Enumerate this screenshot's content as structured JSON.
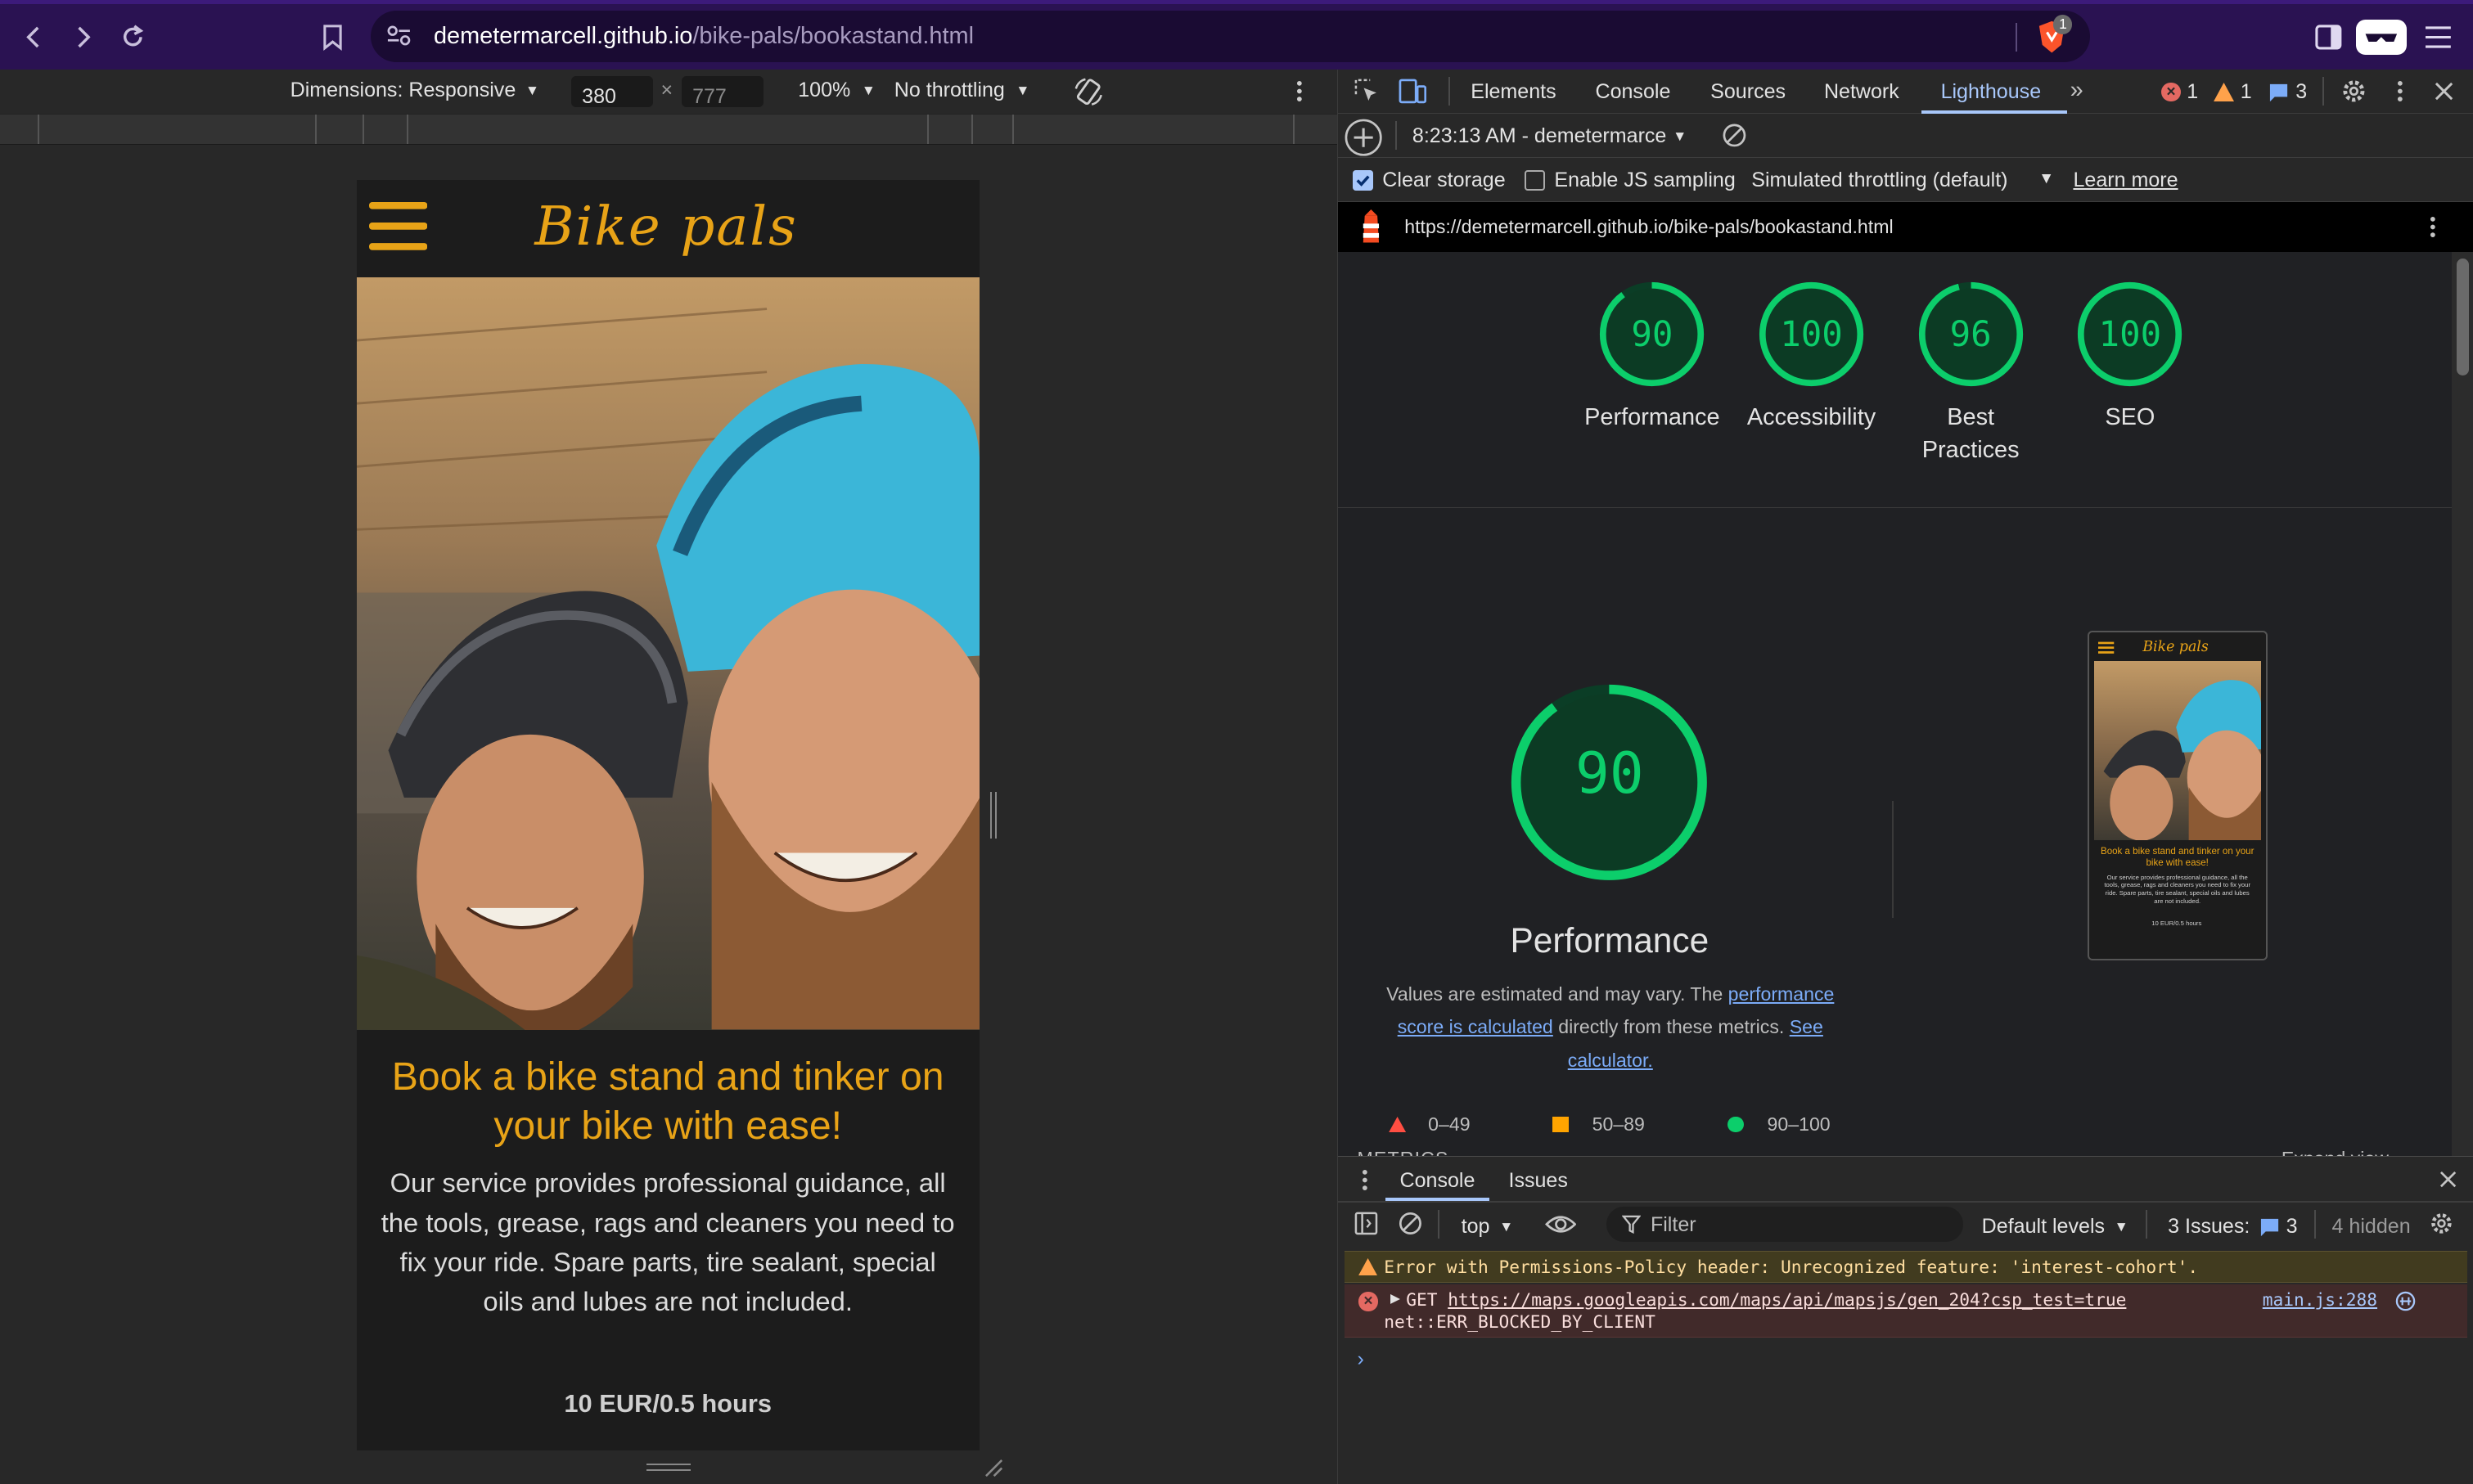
{
  "browser": {
    "url_host": "demetermarcell.github.io",
    "url_path": "/bike-pals/bookastand.html",
    "brave_badge": "1"
  },
  "emulation": {
    "dimensions_label": "Dimensions: Responsive",
    "width": "380",
    "height": "777",
    "zoom": "100%",
    "throttling": "No throttling"
  },
  "page": {
    "logo": "Bike pals",
    "headline": "Book a bike stand and tinker on your bike with ease!",
    "body": "Our service provides professional guidance, all the tools, grease, rags and cleaners you need to fix your ride. Spare parts, tire sealant, special oils and lubes are not included.",
    "price": "10 EUR/0.5 hours"
  },
  "devtools": {
    "tabs": [
      "Elements",
      "Console",
      "Sources",
      "Network",
      "Lighthouse"
    ],
    "active_tab": "Lighthouse",
    "errors": "1",
    "warnings": "1",
    "issues": "3"
  },
  "lighthouse": {
    "report_time": "8:23:13 AM - demetermarce",
    "clear_storage": "Clear storage",
    "js_sampling": "Enable JS sampling",
    "throttling": "Simulated throttling (default)",
    "learn_more": "Learn more",
    "url": "https://demetermarcell.github.io/bike-pals/bookastand.html",
    "scores": [
      {
        "value": 90,
        "label": "Performance"
      },
      {
        "value": 100,
        "label": "Accessibility"
      },
      {
        "value": 96,
        "label": "Best Practices"
      },
      {
        "value": 100,
        "label": "SEO"
      }
    ],
    "perf_score": 90,
    "perf_title": "Performance",
    "desc_1": "Values are estimated and may vary. The ",
    "desc_link1": "performance score is calculated",
    "desc_2": " directly from these metrics. ",
    "desc_link2": "See calculator.",
    "legend": [
      {
        "range": "0–49",
        "color": "#ff4e42"
      },
      {
        "range": "50–89",
        "color": "#ffa400"
      },
      {
        "range": "90–100",
        "color": "#0cce6b"
      }
    ],
    "metrics_label": "METRICS",
    "expand_view": "Expand view",
    "thumb_logo": "Bike pals",
    "thumb_headline": "Book a bike stand and tinker on your bike with ease!",
    "thumb_body": "Our service provides professional guidance, all the tools, grease, rags and cleaners you need to fix your ride. Spare parts, tire sealant, special oils and lubes are not included.",
    "thumb_price": "10 EUR/0.5 hours"
  },
  "drawer": {
    "tabs": [
      "Console",
      "Issues"
    ],
    "context": "top",
    "filter_placeholder": "Filter",
    "levels": "Default levels",
    "issues_label": "3 Issues:",
    "issues_count": "3",
    "hidden": "4 hidden"
  },
  "console": {
    "warning": "Error with Permissions-Policy header: Unrecognized feature: 'interest-cohort'.",
    "error_method": "GET",
    "error_url": "https://maps.googleapis.com/maps/api/mapsjs/gen_204?csp_test=true",
    "error_text": "net::ERR_BLOCKED_BY_CLIENT",
    "error_source": "main.js:288"
  },
  "colors": {
    "accent": "#e8a317",
    "score_green": "#0cce6b",
    "browser_purple": "#2a1252",
    "devtools_blue": "#7cacf8"
  }
}
